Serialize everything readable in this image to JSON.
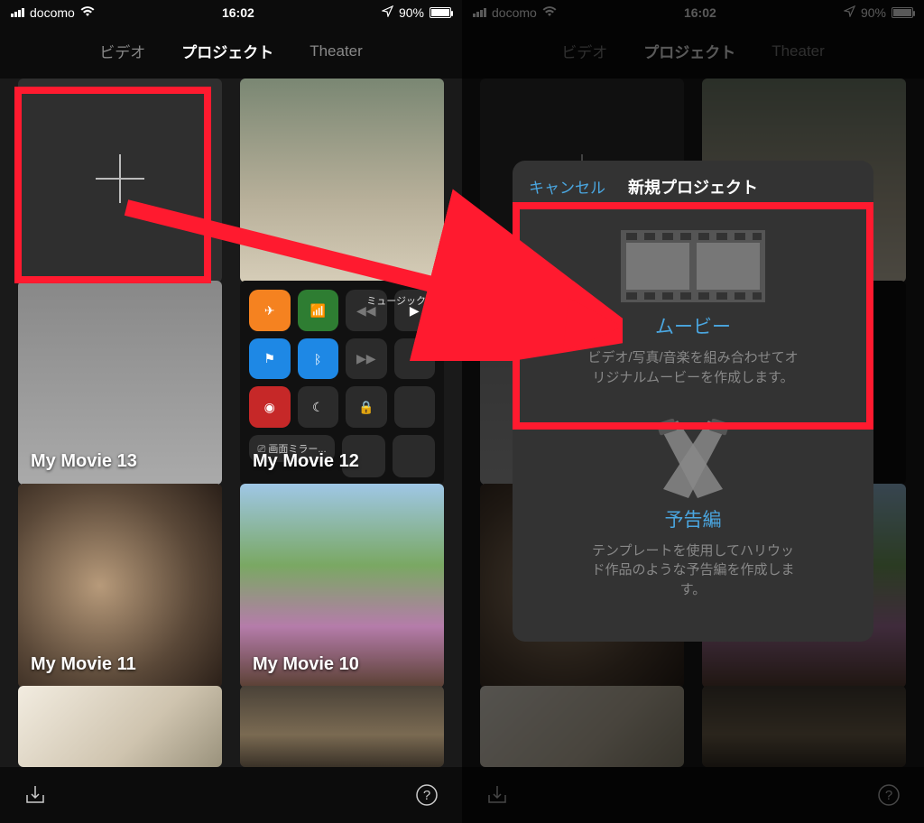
{
  "status": {
    "carrier": "docomo",
    "time": "16:02",
    "battery_pct": "90%"
  },
  "tabs": {
    "video": "ビデオ",
    "project": "プロジェクト",
    "theater": "Theater"
  },
  "projects": {
    "m13": "My Movie 13",
    "m12": "My Movie 12",
    "m11": "My Movie 11",
    "m10": "My Movie 10"
  },
  "cc": {
    "music_label": "ミュージック"
  },
  "modal": {
    "cancel": "キャンセル",
    "title": "新規プロジェクト",
    "movie_title": "ムービー",
    "movie_desc": "ビデオ/写真/音楽を組み合わせてオ\nリジナルムービーを作成します。",
    "trailer_title": "予告編",
    "trailer_desc": "テンプレートを使用してハリウッ\nド作品のような予告編を作成しま\nす。"
  }
}
